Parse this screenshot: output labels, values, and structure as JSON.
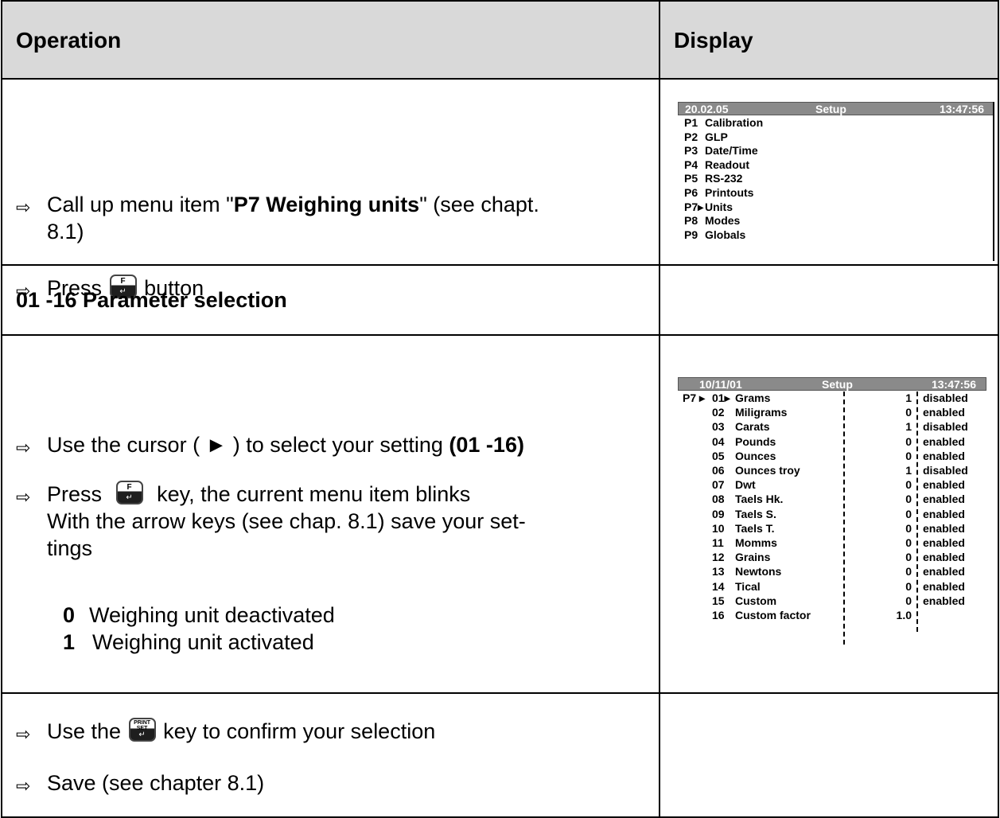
{
  "header": {
    "operation": "Operation",
    "display": "Display"
  },
  "row1": {
    "line1_pre": "Call up menu item \"",
    "line1_bold": "P7 Weighing units",
    "line1_post": "\" (see chapt.",
    "line1_cont": "8.1)",
    "line2_pre": "Press",
    "line2_post": "button",
    "key_f": "F"
  },
  "display1": {
    "bar_date": "20.02.05",
    "bar_title": "Setup",
    "bar_time": "13:47:56",
    "items": [
      {
        "code": "P1",
        "label": "Calibration"
      },
      {
        "code": "P2",
        "label": "GLP"
      },
      {
        "code": "P3",
        "label": "Date/Time"
      },
      {
        "code": "P4",
        "label": "Readout"
      },
      {
        "code": "P5",
        "label": "RS-232"
      },
      {
        "code": "P6",
        "label": "Printouts"
      },
      {
        "code": "P7▸",
        "label": "Units"
      },
      {
        "code": "P8",
        "label": "Modes"
      },
      {
        "code": "P9",
        "label": "Globals"
      }
    ]
  },
  "section": {
    "title": "01 -16 Parameter selection"
  },
  "row3": {
    "line1_pre": "Use the cursor ( ► ) to select your setting ",
    "line1_bold": "(01 -16)",
    "line2_pre": "Press",
    "line2_post": "key, the current menu item blinks",
    "line3": "With the arrow keys (see chap. 8.1) save your set-",
    "line4": "tings",
    "opt0_val": "0",
    "opt0_text": "Weighing unit deactivated",
    "opt1_val": "1",
    "opt1_text": "Weighing unit activated",
    "key_f": "F"
  },
  "display2": {
    "bar_date": "10/11/01",
    "bar_title": "Setup",
    "bar_time": "13:47:56",
    "prefix": "P7 ▸",
    "rows": [
      {
        "num": "01▸",
        "name": "Grams",
        "val": "1",
        "state": "disabled"
      },
      {
        "num": "02",
        "name": "Miligrams",
        "val": "0",
        "state": "enabled"
      },
      {
        "num": "03",
        "name": "Carats",
        "val": "1",
        "state": "disabled"
      },
      {
        "num": "04",
        "name": "Pounds",
        "val": "0",
        "state": "enabled"
      },
      {
        "num": "05",
        "name": "Ounces",
        "val": "0",
        "state": "enabled"
      },
      {
        "num": "06",
        "name": "Ounces troy",
        "val": "1",
        "state": "disabled"
      },
      {
        "num": "07",
        "name": "Dwt",
        "val": "0",
        "state": "enabled"
      },
      {
        "num": "08",
        "name": "Taels Hk.",
        "val": "0",
        "state": "enabled"
      },
      {
        "num": "09",
        "name": "Taels S.",
        "val": "0",
        "state": "enabled"
      },
      {
        "num": "10",
        "name": "Taels T.",
        "val": "0",
        "state": "enabled"
      },
      {
        "num": "11",
        "name": "Momms",
        "val": "0",
        "state": "enabled"
      },
      {
        "num": "12",
        "name": "Grains",
        "val": "0",
        "state": "enabled"
      },
      {
        "num": "13",
        "name": "Newtons",
        "val": "0",
        "state": "enabled"
      },
      {
        "num": "14",
        "name": "Tical",
        "val": "0",
        "state": "enabled"
      },
      {
        "num": "15",
        "name": "Custom",
        "val": "0",
        "state": "enabled"
      },
      {
        "num": "16",
        "name": "Custom factor",
        "val": "1.0",
        "state": ""
      }
    ]
  },
  "row4": {
    "line1_pre": "Use the",
    "line1_post": "key to confirm your selection",
    "line2": "Save (see chapter 8.1)",
    "key_print_top": "PRINT",
    "key_print_bottom": "SET"
  }
}
